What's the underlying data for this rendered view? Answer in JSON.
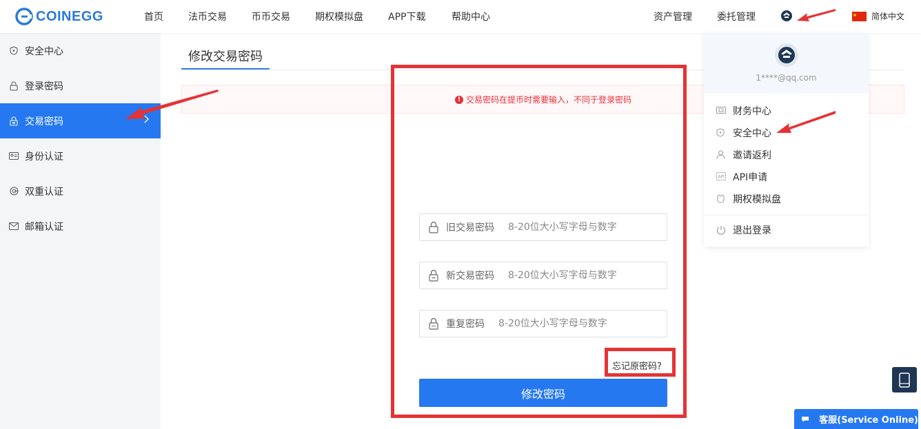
{
  "brand": {
    "logo_text": "COINEGG",
    "accent": "#2678f0",
    "highlight": "#e53335"
  },
  "nav": {
    "items": [
      "首页",
      "法币交易",
      "币币交易",
      "期权模拟盘",
      "APP下载",
      "帮助中心"
    ],
    "right": {
      "assets": "资产管理",
      "orders": "委托管理",
      "language": "简体中文",
      "user_icon": "user-avatar-icon",
      "flag_icon": "china-flag-icon"
    }
  },
  "sidebar": {
    "items": [
      {
        "label": "安全中心",
        "icon": "shield-icon"
      },
      {
        "label": "登录密码",
        "icon": "lock-icon"
      },
      {
        "label": "交易密码",
        "icon": "lock-icon"
      },
      {
        "label": "身份认证",
        "icon": "id-card-icon"
      },
      {
        "label": "双重认证",
        "icon": "google-auth-icon"
      },
      {
        "label": "邮箱认证",
        "icon": "mail-icon"
      }
    ],
    "active_index": 2
  },
  "main": {
    "title": "修改交易密码",
    "notice": "交易密码在提币时需要输入，不同于登录密码",
    "fields": [
      {
        "label": "旧交易密码",
        "placeholder": "8-20位大小写字母与数字",
        "value": ""
      },
      {
        "label": "新交易密码",
        "placeholder": "8-20位大小写字母与数字",
        "value": ""
      },
      {
        "label": "重复密码",
        "placeholder": "8-20位大小写字母与数字",
        "value": ""
      }
    ],
    "forgot": "忘记原密码?",
    "submit": "修改密码"
  },
  "dropdown": {
    "email": "1****@qq.com",
    "items": [
      {
        "label": "财务中心",
        "icon": "wallet-icon"
      },
      {
        "label": "安全中心",
        "icon": "shield-icon"
      },
      {
        "label": "邀请返利",
        "icon": "person-icon"
      },
      {
        "label": "API申请",
        "icon": "api-icon"
      },
      {
        "label": "期权模拟盘",
        "icon": "options-icon"
      }
    ],
    "logout": "退出登录"
  },
  "support": {
    "label": "客服(Service Online)"
  }
}
